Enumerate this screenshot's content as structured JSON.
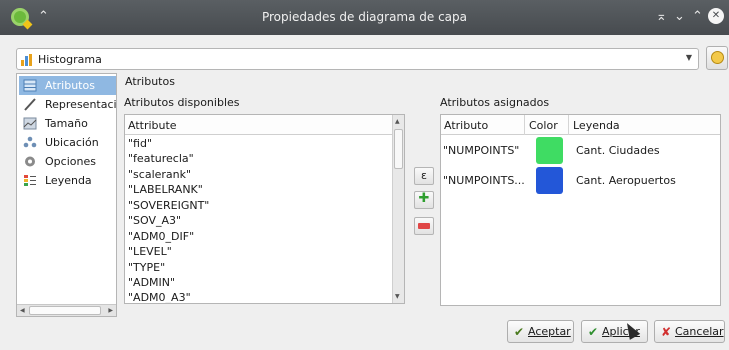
{
  "window": {
    "title": "Propiedades de diagrama de capa",
    "min_glyph": "⌃",
    "controls": [
      "⌅",
      "⌄",
      "⌃"
    ],
    "close_glyph": "✕"
  },
  "renderer": {
    "selected": "Histograma"
  },
  "sidebar": {
    "items": [
      {
        "label": "Atributos",
        "icon": "attributes-icon",
        "selected": true
      },
      {
        "label": "Representación",
        "icon": "brush-icon",
        "selected": false
      },
      {
        "label": "Tamaño",
        "icon": "size-icon",
        "selected": false
      },
      {
        "label": "Ubicación",
        "icon": "placement-icon",
        "selected": false
      },
      {
        "label": "Opciones",
        "icon": "gear-icon",
        "selected": false
      },
      {
        "label": "Leyenda",
        "icon": "legend-icon",
        "selected": false
      }
    ]
  },
  "page": {
    "heading": "Atributos",
    "available_label": "Atributos disponibles",
    "assigned_label": "Atributos asignados"
  },
  "available": {
    "header": "Attribute",
    "rows": [
      "\"fid\"",
      "\"featurecla\"",
      "\"scalerank\"",
      "\"LABELRANK\"",
      "\"SOVEREIGNT\"",
      "\"SOV_A3\"",
      "\"ADM0_DIF\"",
      "\"LEVEL\"",
      "\"TYPE\"",
      "\"ADMIN\"",
      "\"ADM0_A3\""
    ]
  },
  "tools": {
    "expression_glyph": "ε",
    "add_glyph": "✚",
    "remove_glyph": ""
  },
  "assigned": {
    "headers": {
      "attribute": "Atributo",
      "color": "Color",
      "legend": "Leyenda"
    },
    "rows": [
      {
        "attribute": "\"NUMPOINTS\"",
        "color": "#3fdc63",
        "legend": "Cant. Ciudades"
      },
      {
        "attribute": "\"NUMPOINTS...",
        "color": "#2357d8",
        "legend": "Cant. Aeropuertos"
      }
    ]
  },
  "buttons": {
    "ok": "Aceptar",
    "apply": "Aplicar",
    "cancel": "Cancelar"
  }
}
